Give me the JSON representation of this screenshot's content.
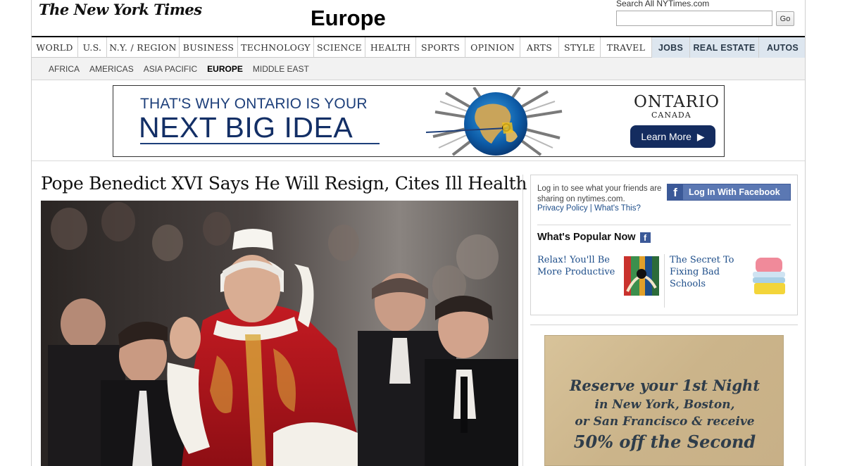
{
  "masthead": {
    "logo": "The New York Times",
    "section_title": "Europe",
    "search_label": "Search All NYTimes.com",
    "search_value": "",
    "search_button": "Go"
  },
  "nav": {
    "items": [
      "WORLD",
      "U.S.",
      "N.Y. / REGION",
      "BUSINESS",
      "TECHNOLOGY",
      "SCIENCE",
      "HEALTH",
      "SPORTS",
      "OPINION",
      "ARTS",
      "STYLE",
      "TRAVEL"
    ],
    "alt_items": [
      "JOBS",
      "REAL ESTATE",
      "AUTOS"
    ]
  },
  "subnav": {
    "items": [
      "AFRICA",
      "AMERICAS",
      "ASIA PACIFIC",
      "EUROPE",
      "MIDDLE EAST"
    ],
    "active": "EUROPE"
  },
  "banner_ad": {
    "line1": "THAT'S WHY ONTARIO IS YOUR",
    "line2": "NEXT BIG IDEA",
    "logo_main": "ONTARIO",
    "logo_sub": "CANADA",
    "cta": "Learn More",
    "cta_icon": "play-triangle-icon"
  },
  "article": {
    "headline": "Pope Benedict XVI Says He Will Resign, Cites Ill Health"
  },
  "facebook": {
    "text": "Log in to see what your friends are sharing on nytimes.com.",
    "privacy_link": "Privacy Policy",
    "separator": "|",
    "whats_this_link": "What's This?",
    "login_button": "Log In With Facebook"
  },
  "popular": {
    "title": "What's Popular Now",
    "items": [
      {
        "title": "Relax! You'll Be More Productive"
      },
      {
        "title": "The Secret To Fixing Bad Schools"
      }
    ]
  },
  "hotel_ad": {
    "line1": "Reserve your 1st Night",
    "line2": "in New York, Boston,",
    "line3": "or San Francisco & receive",
    "line4": "50% off the Second"
  },
  "colors": {
    "accent_blue": "#1e4e8a",
    "facebook_blue": "#3b5998",
    "ad_navy": "#142c5f",
    "pope_red": "#b3141c"
  }
}
